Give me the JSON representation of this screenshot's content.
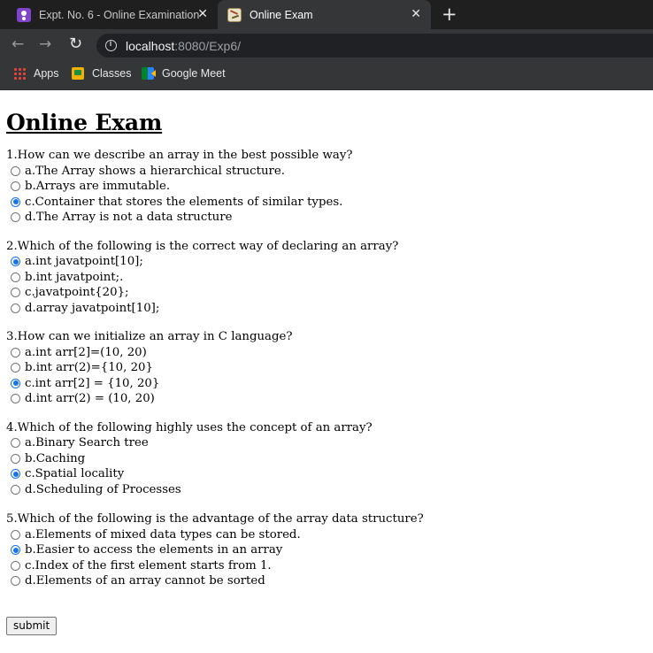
{
  "browser": {
    "tabs": [
      {
        "title": "Expt. No. 6 - Online Examination",
        "favicon": "classroom-icon",
        "active": false
      },
      {
        "title": "Online Exam",
        "favicon": "exam-page-icon",
        "active": true
      }
    ],
    "close_glyph": "✕",
    "new_tab_glyph": "+",
    "url_host": "localhost",
    "url_path": ":8080/Exp6/",
    "bookmarks": [
      "Apps",
      "Classes",
      "Google Meet"
    ]
  },
  "page": {
    "title": "Online Exam",
    "submit_label": "submit",
    "questions": [
      {
        "text": "1.How can we describe an array in the best possible way?",
        "options": [
          "a.The Array shows a hierarchical structure.",
          "b.Arrays are immutable.",
          "c.Container that stores the elements of similar types.",
          "d.The Array is not a data structure"
        ],
        "selected": 2
      },
      {
        "text": "2.Which of the following is the correct way of declaring an array?",
        "options": [
          "a.int javatpoint[10];",
          "b.int javatpoint;.",
          "c.javatpoint{20};",
          "d.array javatpoint[10];"
        ],
        "selected": 0
      },
      {
        "text": "3.How can we initialize an array in C language?",
        "options": [
          "a.int arr[2]=(10, 20)",
          "b.int arr(2)={10, 20}",
          "c.int arr[2] = {10, 20}",
          "d.int arr(2) = (10, 20)"
        ],
        "selected": 2
      },
      {
        "text": "4.Which of the following highly uses the concept of an array?",
        "options": [
          "a.Binary Search tree",
          "b.Caching",
          "c.Spatial locality",
          "d.Scheduling of Processes"
        ],
        "selected": 2
      },
      {
        "text": "5.Which of the following is the advantage of the array data structure?",
        "options": [
          "a.Elements of mixed data types can be stored.",
          "b.Easier to access the elements in an array",
          "c.Index of the first element starts from 1.",
          "d.Elements of an array cannot be sorted"
        ],
        "selected": 1
      }
    ]
  }
}
